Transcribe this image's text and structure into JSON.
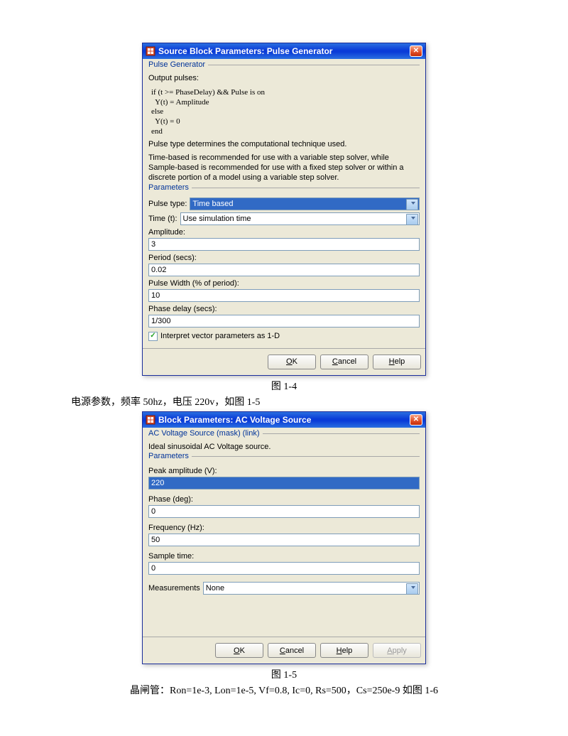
{
  "dialog1": {
    "title": "Source Block Parameters: Pulse Generator",
    "group1_legend": "Pulse Generator",
    "desc1": "Output pulses:",
    "code_line1": "if (t >= PhaseDelay) && Pulse is on",
    "code_line2": "  Y(t) = Amplitude",
    "code_line3": "else",
    "code_line4": "  Y(t) = 0",
    "code_line5": "end",
    "desc2": "Pulse type determines the computational technique used.",
    "desc3": "Time-based is recommended for use with a variable step solver, while Sample-based is recommended for use with a fixed step solver or within a discrete portion of a model using a variable step solver.",
    "group2_legend": "Parameters",
    "pulse_type_label": "Pulse type:",
    "pulse_type_value": "Time based",
    "time_label": "Time (t):",
    "time_value": "Use simulation time",
    "amplitude_label": "Amplitude:",
    "amplitude_value": "3",
    "period_label": "Period (secs):",
    "period_value": "0.02",
    "pulsewidth_label": "Pulse Width (% of period):",
    "pulsewidth_value": "10",
    "phasedelay_label": "Phase delay (secs):",
    "phasedelay_value": "1/300",
    "checkbox_label": "Interpret vector parameters as 1-D",
    "checkbox_checked": true,
    "ok": "OK",
    "cancel": "Cancel",
    "help": "Help"
  },
  "caption1": "图 1-4",
  "bodytext1": "电源参数，频率 50hz，电压 220v，如图 1-5",
  "dialog2": {
    "title": "Block Parameters: AC Voltage Source",
    "group1_legend": "AC Voltage Source (mask) (link)",
    "desc1": "Ideal sinusoidal AC Voltage source.",
    "group2_legend": "Parameters",
    "peak_label": "Peak amplitude (V):",
    "peak_value": "220",
    "phase_label": "Phase (deg):",
    "phase_value": "0",
    "freq_label": "Frequency (Hz):",
    "freq_value": "50",
    "sample_label": "Sample time:",
    "sample_value": "0",
    "meas_label": "Measurements",
    "meas_value": "None",
    "ok": "OK",
    "cancel": "Cancel",
    "help": "Help",
    "apply": "Apply"
  },
  "caption2": "图 1-5",
  "bodytext2": "晶闸管：Ron=1e-3, Lon=1e-5, Vf=0.8, Ic=0, Rs=500，Cs=250e-9 如图 1-6"
}
